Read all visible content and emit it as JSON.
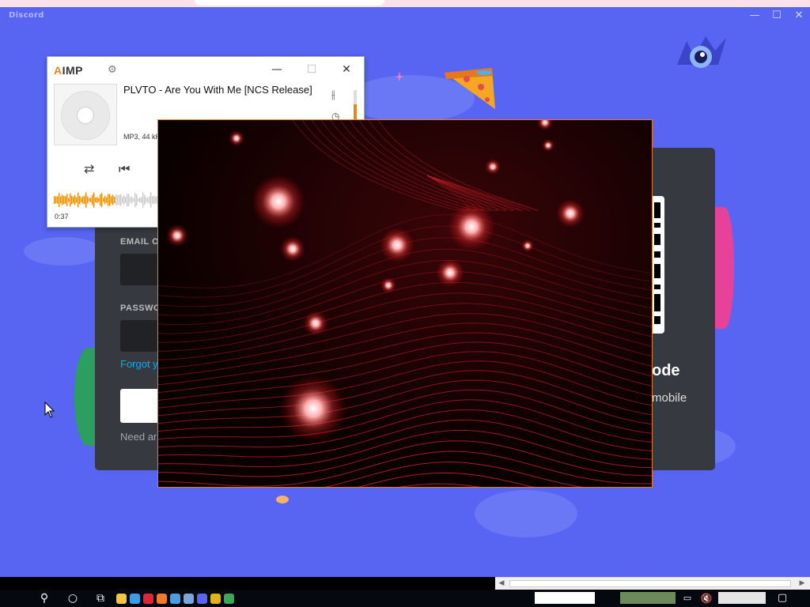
{
  "discord": {
    "title": "Discord",
    "window_controls": {
      "minimize": "—",
      "maximize": "☐",
      "close": "✕"
    },
    "login": {
      "email_label": "EMAIL O",
      "password_label": "PASSWO",
      "forgot_link": "Forgot y",
      "need_account": "Need ar",
      "qr_title": "ode",
      "qr_subtitle": "mobile"
    }
  },
  "aimp": {
    "logo_prefix": "A",
    "logo_rest": "IMP",
    "settings_icon": "gear-icon",
    "window_controls": {
      "minimize": "—",
      "maximize": "☐",
      "close": "✕"
    },
    "track_title": "PLVTO - Are You With Me [NCS Release]",
    "track_meta": "MP3, 44 kH",
    "position_time": "0:37",
    "volume_level": 0.55,
    "progress": 0.55,
    "controls": [
      "repeat-icon",
      "previous-icon"
    ],
    "accent": "#e08a18"
  },
  "visualization": {
    "border_color": "#e07a2a",
    "background": "#0b0000",
    "glow_color": "#ff3b3b"
  },
  "scrollbar": {
    "left_arrow": "◀",
    "right_arrow": "▶"
  },
  "taskbar": {
    "search_icon": "search-icon",
    "cortana_icon": "circle-icon",
    "task_view_icon": "task-view-icon",
    "apps": [
      {
        "name": "file-explorer",
        "color": "#f4c542"
      },
      {
        "name": "edge",
        "color": "#3b9be8"
      },
      {
        "name": "opera",
        "color": "#e0253a"
      },
      {
        "name": "firefox",
        "color": "#f2792a"
      },
      {
        "name": "mail",
        "color": "#4a9fe0"
      },
      {
        "name": "photos",
        "color": "#7aa7d8"
      },
      {
        "name": "discord",
        "color": "#5865f2"
      },
      {
        "name": "aimp",
        "color": "#e0b418"
      },
      {
        "name": "chrome",
        "color": "#3aa757"
      }
    ],
    "tray_icons": [
      "network-icon",
      "volume-muted-icon",
      "keyboard-icon",
      "notification-icon"
    ]
  }
}
